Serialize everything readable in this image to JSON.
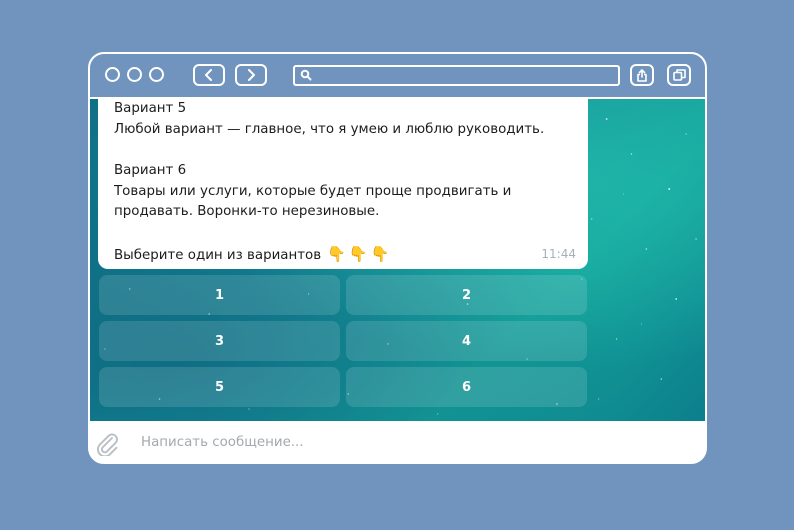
{
  "messages": {
    "option5_title": "Вариант 5",
    "option5_text": "Любой вариант — главное, что я умею и люблю руководить.",
    "option6_title": "Вариант 6",
    "option6_line1": "Товары или услуги, которые будет проще продвигать и",
    "option6_line2": "продавать. Воронки-то нерезиновые.",
    "prompt": "Выберите один из вариантов",
    "prompt_emoji": "👇👇👇",
    "time": "11:44"
  },
  "keyboard": {
    "buttons": [
      "1",
      "2",
      "3",
      "4",
      "5",
      "6"
    ]
  },
  "composer": {
    "placeholder": "Написать сообщение..."
  },
  "colors": {
    "background": "#7094bd",
    "window_frame": "#ffffff",
    "chat_accent": "#14a29b"
  },
  "icons": {
    "window_controls": "circle-icon",
    "back": "chevron-left-icon",
    "forward": "chevron-right-icon",
    "search": "search-icon",
    "share": "share-icon",
    "tabs": "tabs-icon",
    "attach": "paperclip-icon"
  }
}
